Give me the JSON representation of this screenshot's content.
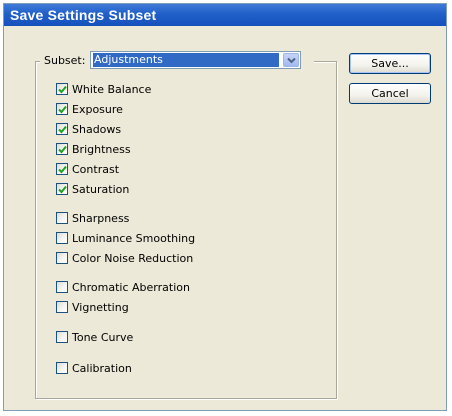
{
  "window": {
    "title": "Save Settings Subset"
  },
  "subset": {
    "label": "Subset:",
    "selected": "Adjustments"
  },
  "buttons": {
    "save": "Save...",
    "cancel": "Cancel"
  },
  "options": [
    {
      "label": "White Balance",
      "checked": true
    },
    {
      "label": "Exposure",
      "checked": true
    },
    {
      "label": "Shadows",
      "checked": true
    },
    {
      "label": "Brightness",
      "checked": true
    },
    {
      "label": "Contrast",
      "checked": true
    },
    {
      "label": "Saturation",
      "checked": true
    },
    {
      "label": "Sharpness",
      "checked": false
    },
    {
      "label": "Luminance Smoothing",
      "checked": false
    },
    {
      "label": "Color Noise Reduction",
      "checked": false
    },
    {
      "label": "Chromatic Aberration",
      "checked": false
    },
    {
      "label": "Vignetting",
      "checked": false
    },
    {
      "label": "Tone Curve",
      "checked": false
    },
    {
      "label": "Calibration",
      "checked": false
    }
  ],
  "colors": {
    "title_bar": "#2160c8",
    "dialog_bg": "#ece9d8",
    "selection": "#316ac5",
    "check": "#21a121"
  },
  "icons": {
    "dropdown": "chevron-down-icon",
    "check": "checkmark-icon"
  }
}
